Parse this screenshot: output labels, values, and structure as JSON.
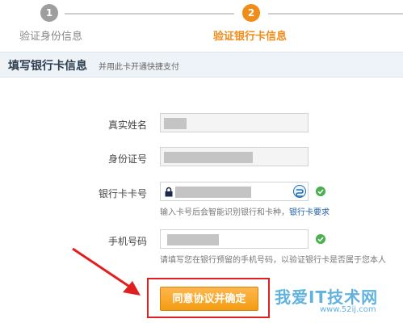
{
  "steps": [
    {
      "number": "1",
      "label": "验证身份信息",
      "state": "done",
      "color": "#9e9e9e"
    },
    {
      "number": "2",
      "label": "验证银行卡信息",
      "state": "active",
      "color": "#f08c1a"
    }
  ],
  "section": {
    "title": "填写银行卡信息",
    "subtitle": "并用此卡开通快捷支付"
  },
  "form": {
    "name": {
      "label": "真实姓名",
      "value": ""
    },
    "id_number": {
      "label": "身份证号",
      "value": ""
    },
    "card_number": {
      "label": "银行卡卡号",
      "value": "",
      "hint": "输入卡号后会智能识别银行和卡种，",
      "hint_link": "银行卡要求"
    },
    "phone": {
      "label": "手机号码",
      "value": "",
      "hint": "请填写您在银行预留的手机号码，以验证银行卡是否属于您本人"
    }
  },
  "submit": {
    "label": "同意协议并确定"
  },
  "watermark": {
    "main": "我爱IT技术网",
    "sub": "www.52ij.com"
  },
  "colors": {
    "accent": "#f08c1a",
    "link": "#1d5fa6",
    "highlight": "#e02020",
    "success": "#4caf50"
  },
  "icons": [
    "check-icon",
    "lock-icon",
    "bank-logo-icon",
    "arrow-annotation"
  ]
}
